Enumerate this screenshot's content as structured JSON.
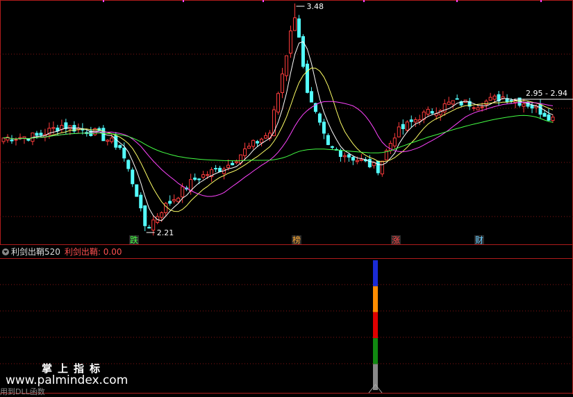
{
  "colors": {
    "background": "#000000",
    "border": "#b01c1c",
    "candle_up": "#ff3c3c",
    "candle_down": "#54ffff",
    "ma5": "#ffffff",
    "ma10": "#ffff66",
    "ma20": "#ff44ff",
    "ma60": "#44ff44",
    "marker_text": "#ffffff"
  },
  "chart_data": [
    {
      "type": "candlestick",
      "title": "",
      "price_range": [
        2.21,
        3.48
      ],
      "annotations": [
        {
          "label": "3.48",
          "kind": "high"
        },
        {
          "label": "2.21",
          "kind": "low"
        },
        {
          "label": "2.95 - 2.94",
          "kind": "last"
        }
      ],
      "moving_averages": [
        "MA5",
        "MA10",
        "MA20",
        "MA60"
      ],
      "event_markers": [
        {
          "label": "跌",
          "color": "#44ff44"
        },
        {
          "label": "榜",
          "color": "#ffaa33"
        },
        {
          "label": "涨",
          "color": "#ff4444"
        },
        {
          "label": "财",
          "color": "#66ccff"
        }
      ]
    },
    {
      "type": "bar",
      "indicator_name": "利剑出鞘520",
      "line_label": "利剑出鞘: 0.00",
      "signal_segments": [
        {
          "color": "#1a2bd6"
        },
        {
          "color": "#ff8c00"
        },
        {
          "color": "#e00000"
        },
        {
          "color": "#118811"
        },
        {
          "color": "#888888"
        }
      ]
    }
  ],
  "watermark": {
    "cn": "掌上指标",
    "url": "www.palmindex.com"
  },
  "footer": {
    "text": "用到DLL函数"
  }
}
